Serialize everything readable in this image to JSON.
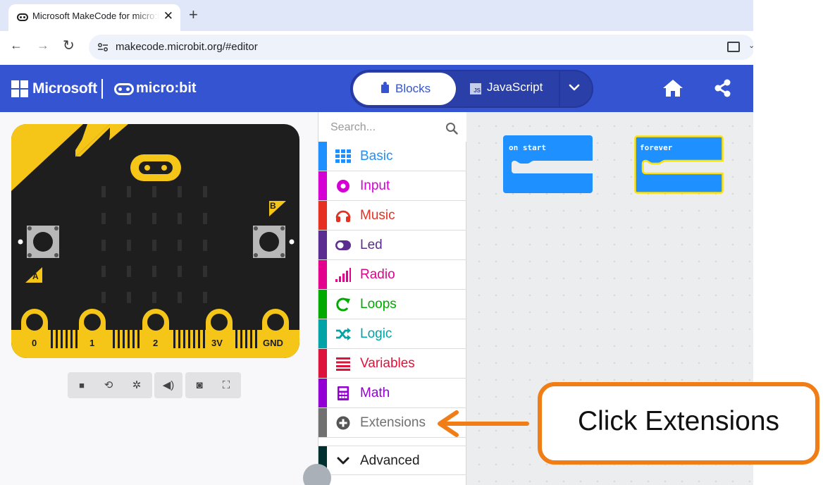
{
  "browser": {
    "tab_title": "Microsoft MakeCode for micro:bit",
    "tab_close_glyph": "✕",
    "new_tab_glyph": "+",
    "back_glyph": "←",
    "forward_glyph": "→",
    "reload_glyph": "↻",
    "url": "makecode.microbit.org/#editor",
    "menu_glyph": "⌄"
  },
  "header": {
    "microsoft_label": "Microsoft",
    "microbit_label": "micro:bit",
    "blocks_label": "Blocks",
    "javascript_label": "JavaScript",
    "js_badge": "JS",
    "accent_color": "#3454d1"
  },
  "search": {
    "placeholder": "Search..."
  },
  "toolbox": {
    "categories": [
      {
        "label": "Basic",
        "color": "#1e90ff",
        "icon": "grid-icon"
      },
      {
        "label": "Input",
        "color": "#d400d4",
        "icon": "target-icon"
      },
      {
        "label": "Music",
        "color": "#e63022",
        "icon": "headphones-icon"
      },
      {
        "label": "Led",
        "color": "#5c2d91",
        "icon": "toggle-icon"
      },
      {
        "label": "Radio",
        "color": "#e3008c",
        "icon": "signal-bars-icon"
      },
      {
        "label": "Loops",
        "color": "#00aa00",
        "icon": "loop-arrow-icon"
      },
      {
        "label": "Logic",
        "color": "#00a4a6",
        "icon": "shuffle-icon"
      },
      {
        "label": "Variables",
        "color": "#dc143c",
        "icon": "lines-icon"
      },
      {
        "label": "Math",
        "color": "#9400d3",
        "icon": "calculator-icon"
      },
      {
        "label": "Extensions",
        "color": "#717171",
        "icon": "plus-circle-icon"
      }
    ],
    "advanced_label": "Advanced",
    "advanced_color": "#002f2f"
  },
  "board": {
    "button_a": "A",
    "button_b": "B",
    "pins": [
      "0",
      "1",
      "2",
      "3V",
      "GND"
    ],
    "board_color": "#1e1e1e",
    "gold_color": "#f5c518"
  },
  "workspace": {
    "on_start_label": "on start",
    "forever_label": "forever",
    "block_color": "#1e90ff",
    "highlight_color": "#ffe000"
  },
  "annotation": {
    "text": "Click Extensions",
    "color": "#f07d16"
  }
}
